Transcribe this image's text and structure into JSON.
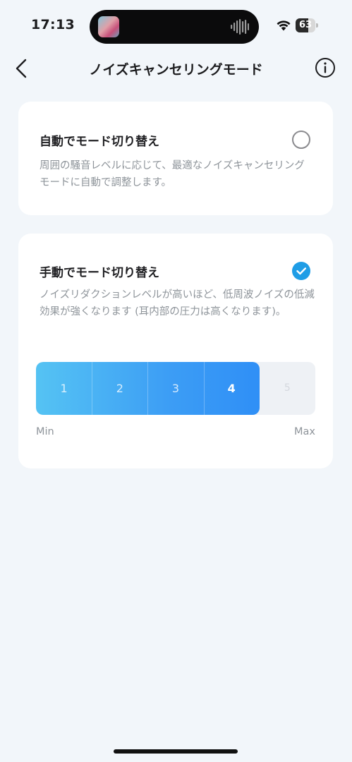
{
  "status_bar": {
    "time": "17:13",
    "battery": "63",
    "battery_level": 0.63
  },
  "nav": {
    "title": "ノイズキャンセリングモード"
  },
  "auto_mode": {
    "title": "自動でモード切り替え",
    "description": "周囲の騒音レベルに応じて、最適なノイズキャンセリングモードに自動で調整します。",
    "selected": false
  },
  "manual_mode": {
    "title": "手動でモード切り替え",
    "description": "ノイズリダクションレベルが高いほど、低周波ノイズの低減効果が強くなります (耳内部の圧力は高くなります)。",
    "selected": true,
    "levels": [
      "1",
      "2",
      "3",
      "4",
      "5"
    ],
    "current_level": 4,
    "min_label": "Min",
    "max_label": "Max"
  },
  "colors": {
    "accent": "#1f9de6",
    "background": "#f2f6fa",
    "card": "#ffffff",
    "muted_text": "#8e949a"
  }
}
